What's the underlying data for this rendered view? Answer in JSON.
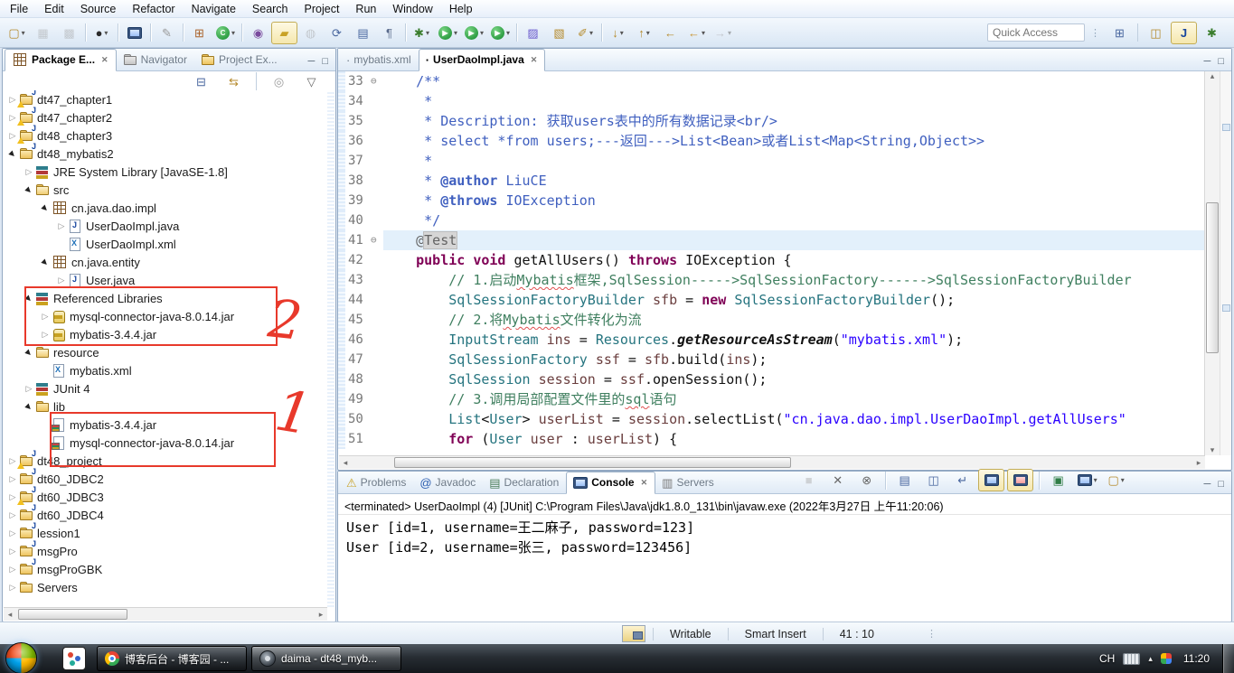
{
  "menu_bar": {
    "items": [
      "File",
      "Edit",
      "Source",
      "Refactor",
      "Navigate",
      "Search",
      "Project",
      "Run",
      "Window",
      "Help"
    ]
  },
  "toolbar": {
    "quick_access_placeholder": "Quick Access",
    "groups": [
      [
        {
          "name": "new-wizard",
          "dd": true
        },
        {
          "name": "save",
          "disabled": true
        },
        {
          "name": "save-all",
          "disabled": true
        }
      ],
      [
        {
          "name": "new-task",
          "dd": true
        }
      ],
      [
        {
          "name": "open-console-view"
        }
      ],
      [
        {
          "name": "skip-all-breakpoints"
        }
      ],
      [
        {
          "name": "new-java-project"
        },
        {
          "name": "new-java-class",
          "dd": true
        }
      ],
      [
        {
          "name": "open-task"
        },
        {
          "name": "mark-occurrences",
          "pressed": true
        },
        {
          "name": "external-tools",
          "disabled": true
        },
        {
          "name": "refresh"
        },
        {
          "name": "open-declaration"
        },
        {
          "name": "show-whitespace"
        }
      ],
      [
        {
          "name": "debug",
          "dd": true
        },
        {
          "name": "run",
          "dd": true
        },
        {
          "name": "coverage",
          "dd": true
        },
        {
          "name": "profile",
          "dd": true
        }
      ],
      [
        {
          "name": "open-type"
        },
        {
          "name": "open-resource"
        },
        {
          "name": "search",
          "dd": true
        }
      ],
      [
        {
          "name": "next-annotation",
          "dd": true
        },
        {
          "name": "previous-annotation",
          "dd": true
        },
        {
          "name": "last-edit-location"
        },
        {
          "name": "back",
          "dd": true
        },
        {
          "name": "forward",
          "disabled": true,
          "dd": true
        }
      ]
    ],
    "perspectives": [
      {
        "name": "open-perspective"
      },
      {
        "name": "javaee-perspective"
      },
      {
        "name": "java-perspective",
        "pressed": true
      },
      {
        "name": "debug-perspective"
      }
    ]
  },
  "package_explorer": {
    "tabs": [
      {
        "label": "Package E...",
        "icon": "package-explorer",
        "active": true,
        "closable": true
      },
      {
        "label": "Navigator",
        "icon": "navigator"
      },
      {
        "label": "Project Ex...",
        "icon": "project-explorer"
      }
    ],
    "view_toolbar": [
      "collapse-all",
      "link-with-editor",
      "focus",
      "view-menu"
    ],
    "tree": [
      {
        "label": "dt47_chapter1",
        "level": 0,
        "arrow": "collapsed",
        "icon": "java-project-warning"
      },
      {
        "label": "dt47_chapter2",
        "level": 0,
        "arrow": "collapsed",
        "icon": "java-project-warning"
      },
      {
        "label": "dt48_chapter3",
        "level": 0,
        "arrow": "collapsed",
        "icon": "java-project-warning"
      },
      {
        "label": "dt48_mybatis2",
        "level": 0,
        "arrow": "expanded",
        "icon": "java-project"
      },
      {
        "label": "JRE System Library [JavaSE-1.8]",
        "level": 1,
        "arrow": "collapsed",
        "icon": "library"
      },
      {
        "label": "src",
        "level": 1,
        "arrow": "expanded",
        "icon": "source-folder"
      },
      {
        "label": "cn.java.dao.impl",
        "level": 2,
        "arrow": "expanded",
        "icon": "package"
      },
      {
        "label": "UserDaoImpl.java",
        "level": 3,
        "arrow": "collapsed",
        "icon": "java-file"
      },
      {
        "label": "UserDaoImpl.xml",
        "level": 3,
        "arrow": "none",
        "icon": "xml-file"
      },
      {
        "label": "cn.java.entity",
        "level": 2,
        "arrow": "expanded",
        "icon": "package"
      },
      {
        "label": "User.java",
        "level": 3,
        "arrow": "collapsed",
        "icon": "java-file"
      },
      {
        "label": "Referenced Libraries",
        "level": 1,
        "arrow": "expanded",
        "icon": "library"
      },
      {
        "label": "mysql-connector-java-8.0.14.jar",
        "level": 2,
        "arrow": "collapsed",
        "icon": "jar"
      },
      {
        "label": "mybatis-3.4.4.jar",
        "level": 2,
        "arrow": "collapsed",
        "icon": "jar"
      },
      {
        "label": "resource",
        "level": 1,
        "arrow": "expanded",
        "icon": "source-folder"
      },
      {
        "label": "mybatis.xml",
        "level": 2,
        "arrow": "none",
        "icon": "xml-file"
      },
      {
        "label": "JUnit 4",
        "level": 1,
        "arrow": "collapsed",
        "icon": "library"
      },
      {
        "label": "lib",
        "level": 1,
        "arrow": "expanded",
        "icon": "folder"
      },
      {
        "label": "mybatis-3.4.4.jar",
        "level": 2,
        "arrow": "none",
        "icon": "plain-file"
      },
      {
        "label": "mysql-connector-java-8.0.14.jar",
        "level": 2,
        "arrow": "none",
        "icon": "plain-file"
      },
      {
        "label": "dt48_project",
        "level": 0,
        "arrow": "collapsed",
        "icon": "java-project-warning"
      },
      {
        "label": "dt60_JDBC2",
        "level": 0,
        "arrow": "collapsed",
        "icon": "java-project"
      },
      {
        "label": "dt60_JDBC3",
        "level": 0,
        "arrow": "collapsed",
        "icon": "java-project-warning"
      },
      {
        "label": "dt60_JDBC4",
        "level": 0,
        "arrow": "collapsed",
        "icon": "java-project"
      },
      {
        "label": "lession1",
        "level": 0,
        "arrow": "collapsed",
        "icon": "java-project"
      },
      {
        "label": "msgPro",
        "level": 0,
        "arrow": "collapsed",
        "icon": "java-project"
      },
      {
        "label": "msgProGBK",
        "level": 0,
        "arrow": "collapsed",
        "icon": "java-project"
      },
      {
        "label": "Servers",
        "level": 0,
        "arrow": "collapsed",
        "icon": "folder"
      }
    ],
    "annotations": [
      {
        "label": "2"
      },
      {
        "label": "1"
      }
    ]
  },
  "editor": {
    "tabs": [
      {
        "label": "mybatis.xml",
        "icon": "xml-file"
      },
      {
        "label": "UserDaoImpl.java",
        "icon": "java-file",
        "active": true,
        "closable": true
      }
    ],
    "lines": [
      {
        "n": "33",
        "fold": true,
        "t": [
          [
            "javadoc",
            "    /**"
          ]
        ]
      },
      {
        "n": "34",
        "t": [
          [
            "javadoc",
            "     *"
          ]
        ]
      },
      {
        "n": "35",
        "t": [
          [
            "javadoc",
            "     * Description: 获取users表中的所有数据记录<br/>"
          ]
        ]
      },
      {
        "n": "36",
        "t": [
          [
            "javadoc",
            "     * select *from users;---返回--->List<Bean>或者List<Map<String,Object>>"
          ]
        ]
      },
      {
        "n": "37",
        "t": [
          [
            "javadoc",
            "     *"
          ]
        ]
      },
      {
        "n": "38",
        "t": [
          [
            "javadoc",
            "     * "
          ],
          [
            "javadoc-tag",
            "@author"
          ],
          [
            "javadoc",
            " LiuCE"
          ]
        ]
      },
      {
        "n": "39",
        "t": [
          [
            "javadoc",
            "     * "
          ],
          [
            "javadoc-tag",
            "@throws"
          ],
          [
            "javadoc",
            " IOException"
          ]
        ]
      },
      {
        "n": "40",
        "t": [
          [
            "javadoc",
            "     */"
          ]
        ]
      },
      {
        "n": "41",
        "fold": true,
        "current": true,
        "t": [
          [
            "annotation",
            "    @"
          ],
          [
            "annotation occurrence",
            "Test"
          ]
        ]
      },
      {
        "n": "42",
        "t": [
          [
            "plain",
            "    "
          ],
          [
            "keyword",
            "public"
          ],
          [
            "plain",
            " "
          ],
          [
            "keyword",
            "void"
          ],
          [
            "plain",
            " getAllUsers() "
          ],
          [
            "keyword",
            "throws"
          ],
          [
            "plain",
            " IOException {"
          ]
        ]
      },
      {
        "n": "43",
        "t": [
          [
            "comment",
            "        // 1.启动"
          ],
          [
            "comment spell",
            "Mybatis"
          ],
          [
            "comment",
            "框架,SqlSession----->SqlSessionFactory------>SqlSessionFactoryBuilder"
          ]
        ]
      },
      {
        "n": "44",
        "t": [
          [
            "plain",
            "        "
          ],
          [
            "type",
            "SqlSessionFactoryBuilder"
          ],
          [
            "plain",
            " "
          ],
          [
            "var",
            "sfb"
          ],
          [
            "plain",
            " = "
          ],
          [
            "keyword",
            "new"
          ],
          [
            "plain",
            " "
          ],
          [
            "type",
            "SqlSessionFactoryBuilder"
          ],
          [
            "plain",
            "();"
          ]
        ]
      },
      {
        "n": "45",
        "t": [
          [
            "comment",
            "        // 2.将"
          ],
          [
            "comment spell",
            "Mybatis"
          ],
          [
            "comment",
            "文件转化为流"
          ]
        ]
      },
      {
        "n": "46",
        "t": [
          [
            "plain",
            "        "
          ],
          [
            "type",
            "InputStream"
          ],
          [
            "plain",
            " "
          ],
          [
            "var",
            "ins"
          ],
          [
            "plain",
            " = "
          ],
          [
            "type",
            "Resources"
          ],
          [
            "plain",
            "."
          ],
          [
            "static-method",
            "getResourceAsStream"
          ],
          [
            "plain",
            "("
          ],
          [
            "string",
            "\"mybatis.xml\""
          ],
          [
            "plain",
            ");"
          ]
        ]
      },
      {
        "n": "47",
        "t": [
          [
            "plain",
            "        "
          ],
          [
            "type",
            "SqlSessionFactory"
          ],
          [
            "plain",
            " "
          ],
          [
            "var",
            "ssf"
          ],
          [
            "plain",
            " = "
          ],
          [
            "var",
            "sfb"
          ],
          [
            "plain",
            ".build("
          ],
          [
            "var",
            "ins"
          ],
          [
            "plain",
            ");"
          ]
        ]
      },
      {
        "n": "48",
        "t": [
          [
            "plain",
            "        "
          ],
          [
            "type",
            "SqlSession"
          ],
          [
            "plain",
            " "
          ],
          [
            "var",
            "session"
          ],
          [
            "plain",
            " = "
          ],
          [
            "var",
            "ssf"
          ],
          [
            "plain",
            ".openSession();"
          ]
        ]
      },
      {
        "n": "49",
        "t": [
          [
            "comment",
            "        // 3.调用局部配置文件里的"
          ],
          [
            "comment spell",
            "sql"
          ],
          [
            "comment",
            "语句"
          ]
        ]
      },
      {
        "n": "50",
        "t": [
          [
            "plain",
            "        "
          ],
          [
            "type",
            "List"
          ],
          [
            "plain",
            "<"
          ],
          [
            "type",
            "User"
          ],
          [
            "plain",
            "> "
          ],
          [
            "var",
            "userList"
          ],
          [
            "plain",
            " = "
          ],
          [
            "var",
            "session"
          ],
          [
            "plain",
            ".selectList("
          ],
          [
            "string",
            "\"cn.java.dao.impl.UserDaoImpl.getAllUsers\""
          ]
        ]
      },
      {
        "n": "51",
        "t": [
          [
            "plain",
            "        "
          ],
          [
            "keyword",
            "for"
          ],
          [
            "plain",
            " ("
          ],
          [
            "type",
            "User"
          ],
          [
            "plain",
            " "
          ],
          [
            "var",
            "user"
          ],
          [
            "plain",
            " : "
          ],
          [
            "var",
            "userList"
          ],
          [
            "plain",
            ") {"
          ]
        ]
      }
    ]
  },
  "console": {
    "tabs": [
      {
        "label": "Problems",
        "icon": "problems"
      },
      {
        "label": "Javadoc",
        "icon": "javadoc"
      },
      {
        "label": "Declaration",
        "icon": "declaration"
      },
      {
        "label": "Console",
        "icon": "console",
        "active": true,
        "closable": true
      },
      {
        "label": "Servers",
        "icon": "servers"
      }
    ],
    "toolbar": [
      {
        "name": "terminate",
        "disabled": true
      },
      {
        "name": "remove-launch"
      },
      {
        "name": "remove-all-launches"
      },
      {
        "sep": true
      },
      {
        "name": "clear-console"
      },
      {
        "name": "scroll-lock"
      },
      {
        "name": "word-wrap"
      },
      {
        "name": "show-console-stdout",
        "pressed": true
      },
      {
        "name": "show-console-stderr",
        "pressed": true
      },
      {
        "sep": true
      },
      {
        "name": "pin-console"
      },
      {
        "name": "display-console",
        "dd": true
      },
      {
        "name": "open-console",
        "dd": true
      }
    ],
    "header": "<terminated> UserDaoImpl (4) [JUnit] C:\\Program Files\\Java\\jdk1.8.0_131\\bin\\javaw.exe (2022年3月27日 上午11:20:06)",
    "output": [
      "User [id=1, username=王二麻子, password=123]",
      "User [id=2, username=张三, password=123456]"
    ]
  },
  "status_bar": {
    "writable": "Writable",
    "input_mode": "Smart Insert",
    "caret_position": "41 : 10"
  },
  "taskbar": {
    "tasks": [
      {
        "label": "博客后台 - 博客园 - ...",
        "icon": "chrome"
      },
      {
        "label": "daima - dt48_myb...",
        "icon": "eclipse",
        "active": true
      }
    ],
    "tray": {
      "language": "CH",
      "time": "11:20"
    }
  },
  "colors": {
    "red_annotation": "#e8392b",
    "current_line_highlight": "#e3f0fb",
    "keyword": "#7f0055",
    "string": "#2a00ff",
    "comment": "#3f7f5f",
    "javadoc": "#3f5fbf",
    "type": "#25747f"
  }
}
